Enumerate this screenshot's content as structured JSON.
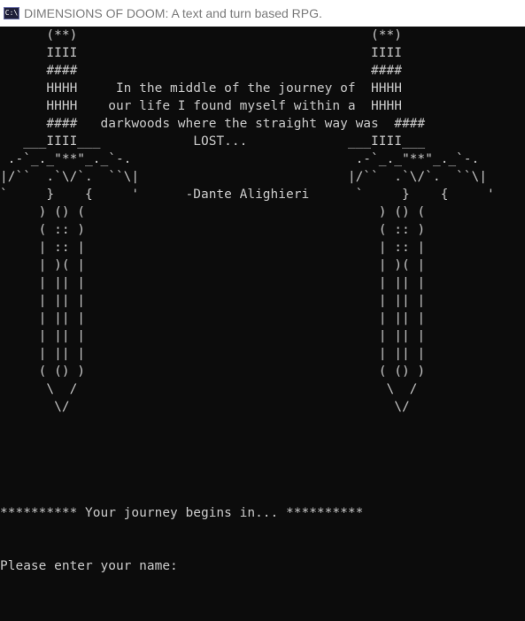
{
  "window": {
    "icon": "console-app-icon",
    "icon_glyph": "C:\\",
    "title": "DIMENSIONS OF DOOM: A text and turn based RPG."
  },
  "console": {
    "lines": [
      "      (**)                                      (**)",
      "      IIII                                      IIII",
      "      ####                                      ####",
      "      HHHH     In the middle of the journey of  HHHH",
      "      HHHH    our life I found myself within a  HHHH",
      "      ####   darkwoods where the straight way was  ####",
      "   ___IIII___            LOST...             ___IIII___",
      " .-`_._\"**\"_._`-.                             .-`_._\"**\"_._`-.",
      "|/``  .`\\/`.  ``\\|                           |/``  .`\\/`.  ``\\|",
      "`     }    {     '      -Dante Alighieri      `     }    {     '",
      "     ) () (                                      ) () (",
      "     ( :: )                                      ( :: )",
      "     | :: |                                      | :: |",
      "     | )( |                                      | )( |",
      "     | || |                                      | || |",
      "     | || |                                      | || |",
      "     | || |                                      | || |",
      "     | || |                                      | || |",
      "     | || |                                      | || |",
      "     ( () )                                      ( () )",
      "      \\  /                                        \\  /",
      "       \\/                                          \\/",
      "",
      "",
      "",
      "",
      "",
      "********** Your journey begins in... **********",
      "",
      "",
      "Please enter your name:"
    ]
  }
}
